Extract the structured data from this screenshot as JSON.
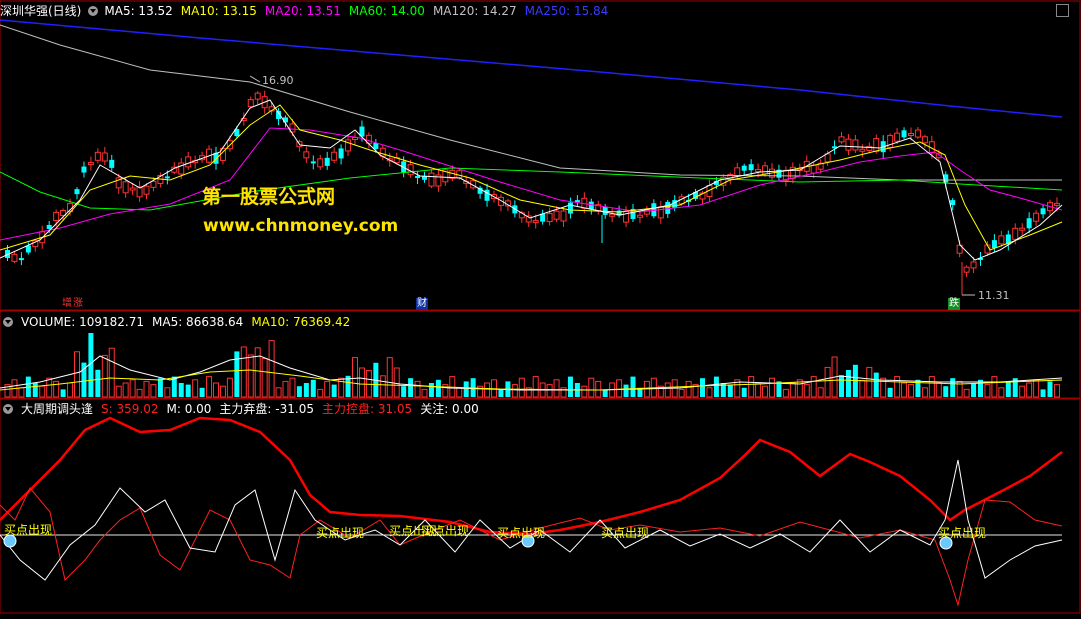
{
  "price_panel": {
    "stock": "深圳华强(日线)",
    "ma": [
      {
        "label": "MA5: 13.52",
        "color": "#ffffff"
      },
      {
        "label": "MA10: 13.15",
        "color": "#ffff00"
      },
      {
        "label": "MA20: 13.51",
        "color": "#ff00ff"
      },
      {
        "label": "MA60: 14.00",
        "color": "#00ff00"
      },
      {
        "label": "MA120: 14.27",
        "color": "#c0c0c0"
      },
      {
        "label": "MA250: 15.84",
        "color": "#2020ff"
      }
    ],
    "high_label": "16.90",
    "low_label": "11.31",
    "event_labels": [
      "增",
      "涨",
      "财",
      "跌"
    ]
  },
  "watermark": {
    "line1": "第一股票公式网",
    "line2": "www.chnmoney.com"
  },
  "volume_panel": {
    "title": "VOLUME: 109182.71",
    "ma5": "MA5: 86638.64",
    "ma10": "MA10: 76369.42"
  },
  "indicator_panel": {
    "title": "大周期调头逢",
    "s": "S: 359.02",
    "m": "M: 0.00",
    "abandon": "主力弃盘: -31.05",
    "control": "主力控盘: 31.05",
    "focus": "关注: 0.00",
    "signals": [
      "买点出现",
      "买点出现",
      "买点出现",
      "买点出现",
      "买点出现",
      "买点出现",
      "买点出现"
    ]
  },
  "colors": {
    "up": "#ff3232",
    "down": "#00ffff",
    "axis": "#a00000",
    "red_line": "#ff0000",
    "white_line": "#ffffff",
    "yellow": "#ffff00"
  },
  "chart_data": {
    "type": "candlestick",
    "price_range": [
      11.0,
      17.5
    ],
    "labeled_high": 16.9,
    "labeled_low": 11.31
  }
}
